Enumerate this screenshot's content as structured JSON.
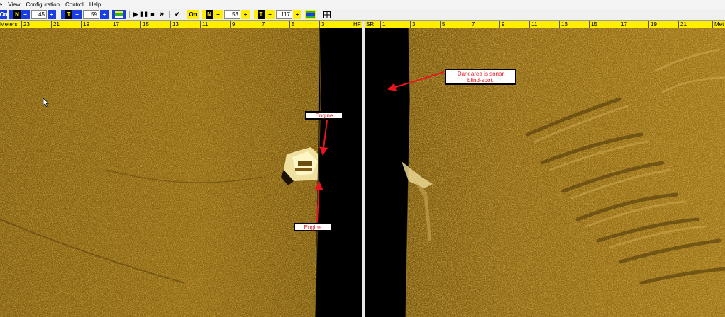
{
  "menu": [
    "le",
    "View",
    "Configuration",
    "Control",
    "Help"
  ],
  "toolbar": {
    "on_left": "On",
    "n_icon": "N",
    "minus": "−",
    "plus": "+",
    "t_icon": "T",
    "n_value_left": "45",
    "t_value_left": "59",
    "play": "▶",
    "pause": "❚❚",
    "stop": "■",
    "fast_forward": "»",
    "check": "✔",
    "on_right": "On",
    "n_value_right": "53",
    "t_value_right": "117"
  },
  "left_ruler": {
    "unit": "Meters",
    "ticks": [
      "23",
      "21",
      "19",
      "17",
      "15",
      "13",
      "11",
      "9",
      "7",
      "5",
      "3"
    ],
    "channel": "HF"
  },
  "right_ruler": {
    "channel": "SR",
    "ticks": [
      "1",
      "3",
      "5",
      "7",
      "9",
      "11",
      "13",
      "15",
      "17",
      "19",
      "21"
    ],
    "unit": "Met"
  },
  "annotations": {
    "engine_top": "Engine",
    "engine_bottom": "Engine",
    "blind_spot_line1": "Dark area is sonar",
    "blind_spot_line2": "blind-spot."
  },
  "colors": {
    "seabed": "#8a6212",
    "blind_spot": "#000000",
    "ruler": "#ffee00",
    "annotation_text": "#e8141e",
    "toolbar_blue": "#1a3fe0"
  }
}
